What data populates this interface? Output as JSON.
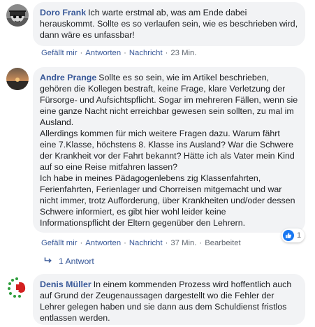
{
  "comments": [
    {
      "author": "Doro Frank",
      "text": "Ich warte erstmal ab, was am Ende dabei herauskommt. Sollte es so verlaufen sein, wie es beschrieben wird, dann wäre es unfassbar!",
      "actions": {
        "like": "Gefällt mir",
        "reply": "Antworten",
        "message": "Nachricht",
        "time": "23 Min."
      }
    },
    {
      "author": "Andre Prange",
      "text": "Sollte es so sein, wie im Artikel beschrieben, gehören die Kollegen bestraft, keine Frage, klare Verletzung der Fürsorge- und Aufsichtspflicht. Sogar im mehreren Fällen, wenn sie eine ganze Nacht nicht erreichbar gewesen sein sollten, zu mal im Ausland.\nAllerdings kommen für mich weitere Fragen dazu. Warum fährt eine 7.Klasse, höchstens 8. Klasse ins Ausland? War die Schwere der Krankheit vor der Fahrt bekannt? Hätte ich als Vater mein Kind auf so eine Reise mitfahren lassen?\nIch habe in meines Pädagogenlebens zig Klassenfahrten, Ferienfahrten, Ferienlager und Chorreisen mitgemacht und war nicht immer, trotz Aufforderung, über Krankheiten und/oder dessen Schwere informiert, es gibt hier wohl leider keine Informationspflicht der Eltern gegenüber den Lehrern.",
      "actions": {
        "like": "Gefällt mir",
        "reply": "Antworten",
        "message": "Nachricht",
        "time": "37 Min.",
        "edited": "Bearbeitet"
      },
      "reaction_count": "1",
      "replies_label": "1 Antwort"
    },
    {
      "author": "Denis Müller",
      "text": "In einem kommenden Prozess wird hoffentlich auch auf Grund der Zeugenaussagen dargestellt wo die Fehler der Lehrer gelegen haben und sie dann aus dem Schuldienst fristlos entlassen werden."
    }
  ],
  "icons": {
    "reply_arrow": "reply-arrow-icon",
    "like_reaction": "thumbs-up-icon"
  },
  "colors": {
    "link": "#385898",
    "bubble": "#f2f3f5",
    "meta": "#606770",
    "like_blue": "#1877f2"
  }
}
